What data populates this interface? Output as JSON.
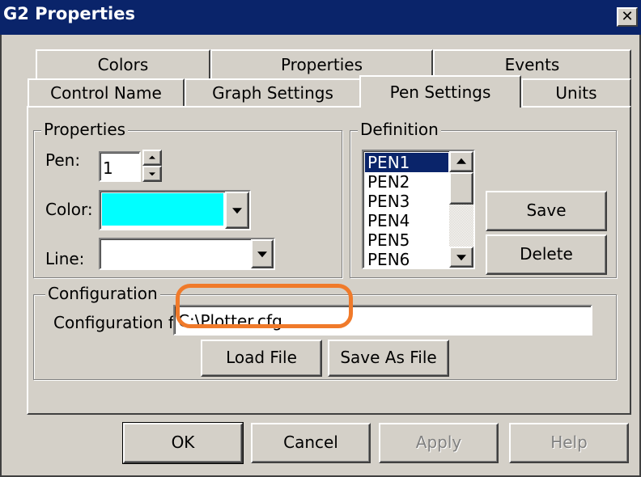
{
  "window": {
    "title": "G2 Properties",
    "close_glyph": "✕"
  },
  "tabs": {
    "back": [
      "Colors",
      "Properties",
      "Events"
    ],
    "front": [
      "Control Name",
      "Graph Settings",
      "Pen Settings",
      "Units"
    ],
    "active": "Pen Settings"
  },
  "properties_group": {
    "legend": "Properties",
    "pen_label": "Pen:",
    "pen_value": "1",
    "color_label": "Color:",
    "color_value": "#00ffff",
    "line_label": "Line:",
    "line_value": ""
  },
  "definition_group": {
    "legend": "Definition",
    "pens": [
      "PEN1",
      "PEN2",
      "PEN3",
      "PEN4",
      "PEN5",
      "PEN6"
    ],
    "selected": "PEN1",
    "save_label": "Save",
    "delete_label": "Delete"
  },
  "configuration_group": {
    "legend": "Configuration",
    "file_label": "Configuration file:",
    "file_value": "C:\\Plotter.cfg",
    "load_label": "Load File",
    "save_as_label": "Save As File"
  },
  "footer": {
    "ok_label": "OK",
    "cancel_label": "Cancel",
    "apply_label": "Apply",
    "help_label": "Help"
  },
  "colors": {
    "titlebar": "#0a246a",
    "face": "#d4d0c8",
    "selection": "#0a246a",
    "highlight_annotation": "#f07a2a"
  }
}
